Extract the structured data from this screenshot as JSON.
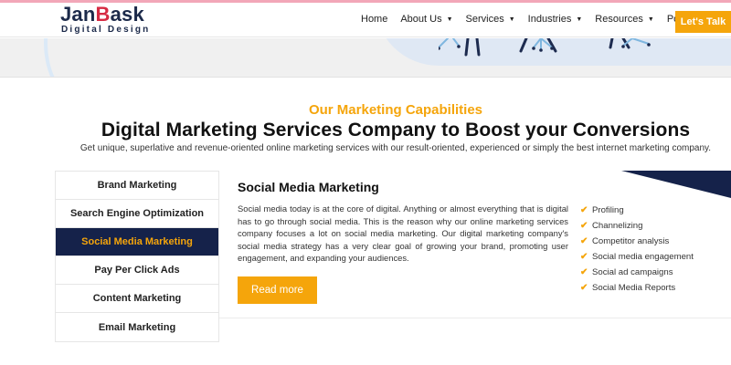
{
  "header": {
    "logo_main": "JanBask",
    "logo_b": "B",
    "logo_sub": "Digital Design",
    "nav": [
      {
        "label": "Home",
        "has_caret": false
      },
      {
        "label": "About Us",
        "has_caret": true
      },
      {
        "label": "Services",
        "has_caret": true
      },
      {
        "label": "Industries",
        "has_caret": true
      },
      {
        "label": "Resources",
        "has_caret": true
      },
      {
        "label": "Portfolio",
        "has_caret": false
      }
    ],
    "cta_label": "Let's Talk"
  },
  "section": {
    "kicker": "Our Marketing Capabilities",
    "title": "Digital Marketing Services Company to Boost your Conversions",
    "subtitle": "Get unique, superlative and revenue-oriented online marketing services with our result-oriented, experienced or simply the best internet marketing company."
  },
  "tabs": [
    {
      "label": "Brand Marketing",
      "active": false
    },
    {
      "label": "Search Engine Optimization",
      "active": false
    },
    {
      "label": "Social Media Marketing",
      "active": true
    },
    {
      "label": "Pay Per Click Ads",
      "active": false
    },
    {
      "label": "Content Marketing",
      "active": false
    },
    {
      "label": "Email Marketing",
      "active": false
    }
  ],
  "panel": {
    "title": "Social Media Marketing",
    "text": "Social media today is at the core of digital. Anything or almost everything that is digital has to go through social media. This is the reason why our online marketing services company focuses a lot on social media marketing. Our digital marketing company's social media strategy has a very clear goal of growing your brand, promoting user engagement, and expanding your audiences.",
    "button_label": "Read more",
    "features": [
      "Profiling",
      "Channelizing",
      "Competitor analysis",
      "Social media engagement",
      "Social ad campaigns",
      "Social Media Reports"
    ]
  },
  "colors": {
    "accent": "#f5a50b",
    "navy": "#15224a",
    "logo_red": "#d62b43"
  }
}
